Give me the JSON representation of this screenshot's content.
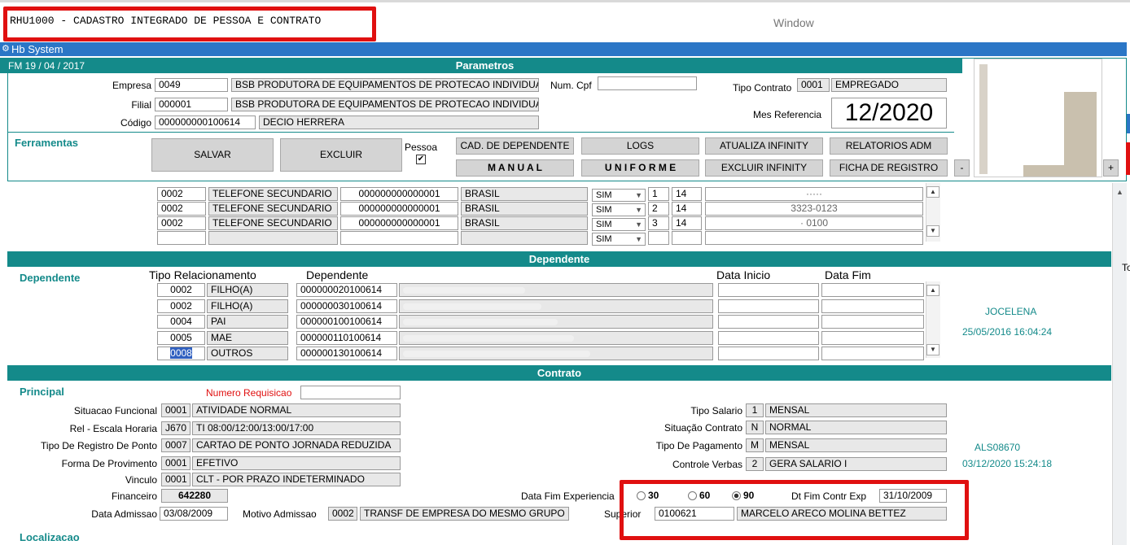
{
  "window": {
    "title": "RHU1000 - CADASTRO INTEGRADO DE PESSOA E CONTRATO",
    "label": "Window"
  },
  "app": {
    "title": "Hb System",
    "date": "FM 19 / 04 / 2017"
  },
  "parametros": {
    "header": "Parametros",
    "empresa_label": "Empresa",
    "empresa_code": "0049",
    "empresa_name": "BSB PRODUTORA DE EQUIPAMENTOS DE  PROTECAO INDIVIDUA",
    "filial_label": "Filial",
    "filial_code": "000001",
    "filial_name": "BSB PRODUTORA DE EQUIPAMENTOS DE PROTECAO INDIVIDUA",
    "codigo_label": "Código",
    "codigo_code": "000000000100614",
    "codigo_name": "DECIO HERRERA",
    "cpf_label": "Num. Cpf",
    "cpf_value": "",
    "tipo_label": "Tipo Contrato",
    "tipo_code": "0001",
    "tipo_name": "EMPREGADO",
    "mes_label": "Mes Referencia",
    "mes_value": "12/2020"
  },
  "ferramentas": {
    "label": "Ferramentas",
    "salvar": "SALVAR",
    "excluir": "EXCLUIR",
    "pessoa": "Pessoa",
    "pessoa_check": "✔",
    "cad_dep": "CAD. DE DEPENDENTE",
    "logs": "LOGS",
    "atualiza": "ATUALIZA INFINITY",
    "relatorios": "RELATORIOS ADM",
    "manual": "M A N U A L",
    "uniforme": "U N I F O R M E",
    "excluir_inf": "EXCLUIR  INFINITY",
    "ficha": "FICHA DE REGISTRO",
    "minus": "-",
    "plus": "+"
  },
  "phones": {
    "rows": [
      {
        "code": "0002",
        "type": "TELEFONE SECUNDARIO",
        "doc": "000000000000001",
        "country": "BRASIL",
        "sim": "SIM",
        "n": "1",
        "ddd": "14",
        "num": "·····"
      },
      {
        "code": "0002",
        "type": "TELEFONE SECUNDARIO",
        "doc": "000000000000001",
        "country": "BRASIL",
        "sim": "SIM",
        "n": "2",
        "ddd": "14",
        "num": "3323-0123"
      },
      {
        "code": "0002",
        "type": "TELEFONE SECUNDARIO",
        "doc": "000000000000001",
        "country": "BRASIL",
        "sim": "SIM",
        "n": "3",
        "ddd": "14",
        "num": "· 0100"
      },
      {
        "code": "",
        "type": "",
        "doc": "",
        "country": "",
        "sim": "SIM",
        "n": "",
        "ddd": "",
        "num": ""
      }
    ]
  },
  "dependente": {
    "header": "Dependente",
    "label": "Dependente",
    "col_tipo": "Tipo Relacionamento",
    "col_dep": "Dependente",
    "col_inicio": "Data Inicio",
    "col_fim": "Data Fim",
    "user": "JOCELENA",
    "datetime": "25/05/2016 16:04:24",
    "rows": [
      {
        "code": "0002",
        "rel": "FILHO(A)",
        "id": "000000020100614"
      },
      {
        "code": "0002",
        "rel": "FILHO(A)",
        "id": "000000030100614"
      },
      {
        "code": "0004",
        "rel": "PAI",
        "id": "000000100100614"
      },
      {
        "code": "0005",
        "rel": "MAE",
        "id": "000000110100614"
      },
      {
        "code": "0008",
        "rel": "OUTROS",
        "id": "000000130100614"
      }
    ]
  },
  "contrato": {
    "header": "Contrato",
    "principal": "Principal",
    "num_req_label": "Numero Requisicao",
    "num_req": "",
    "sit_label": "Situacao Funcional",
    "sit_code": "0001",
    "sit_name": "ATIVIDADE NORMAL",
    "esc_label": "Rel - Escala Horaria",
    "esc_code": "J670",
    "esc_name": "TI 08:00/12:00/13:00/17:00",
    "reg_label": "Tipo De Registro De Ponto",
    "reg_code": "0007",
    "reg_name": "CARTAO DE PONTO JORNADA REDUZIDA",
    "prov_label": "Forma De Provimento",
    "prov_code": "0001",
    "prov_name": "EFETIVO",
    "vinc_label": "Vinculo",
    "vinc_code": "0001",
    "vinc_name": "CLT - POR PRAZO INDETERMINADO",
    "fin_label": "Financeiro",
    "fin_value": "642280",
    "adm_label": "Data Admissao",
    "adm_value": "03/08/2009",
    "mot_label": "Motivo Admissao",
    "mot_code": "0002",
    "mot_name": "TRANSF DE EMPRESA DO MESMO GRUPO E",
    "tsal_label": "Tipo Salario",
    "tsal_code": "1",
    "tsal_name": "MENSAL",
    "scon_label": "Situação Contrato",
    "scon_code": "N",
    "scon_name": "NORMAL",
    "tpag_label": "Tipo De Pagamento",
    "tpag_code": "M",
    "tpag_name": "MENSAL",
    "cver_label": "Controle Verbas",
    "cver_code": "2",
    "cver_name": "GERA SALARIO I",
    "dfe_label": "Data Fim Experiencia",
    "opt30": "30",
    "opt60": "60",
    "opt90": "90",
    "dtfim_label": "Dt Fim Contr Exp",
    "dtfim_value": "31/10/2009",
    "sup_label": "Superior",
    "sup_code": "0100621",
    "sup_name": "MARCELO ARECO MOLINA BETTEZ",
    "user": "ALS08670",
    "datetime": "03/12/2020 15:24:18"
  },
  "localizacao": {
    "label": "Localizacao"
  },
  "side": {
    "to": "To"
  }
}
